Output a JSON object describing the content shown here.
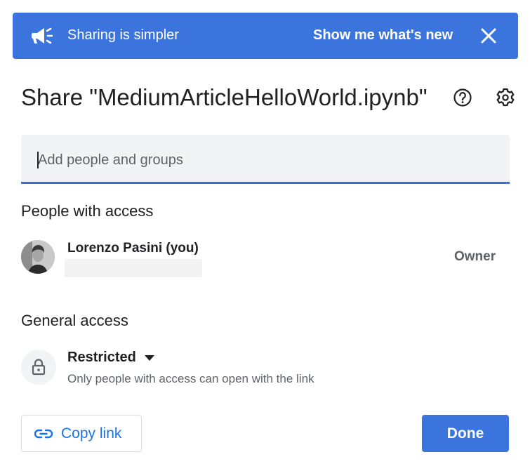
{
  "banner": {
    "message": "Sharing is simpler",
    "cta": "Show me what's new",
    "icon": "megaphone-icon",
    "background": "#3c74de"
  },
  "dialog": {
    "title": "Share \"MediumArticleHelloWorld.ipynb\"",
    "help_icon": "help-circle-icon",
    "settings_icon": "gear-icon"
  },
  "search": {
    "placeholder": "Add people and groups",
    "value": ""
  },
  "people_with_access": {
    "heading": "People with access",
    "people": [
      {
        "name": "Lorenzo Pasini (you)",
        "role": "Owner"
      }
    ]
  },
  "general_access": {
    "heading": "General access",
    "level": "Restricted",
    "description": "Only people with access can open with the link",
    "icon": "lock-icon"
  },
  "footer": {
    "copy_link": "Copy link",
    "done": "Done",
    "accent": "#1a73e8"
  }
}
